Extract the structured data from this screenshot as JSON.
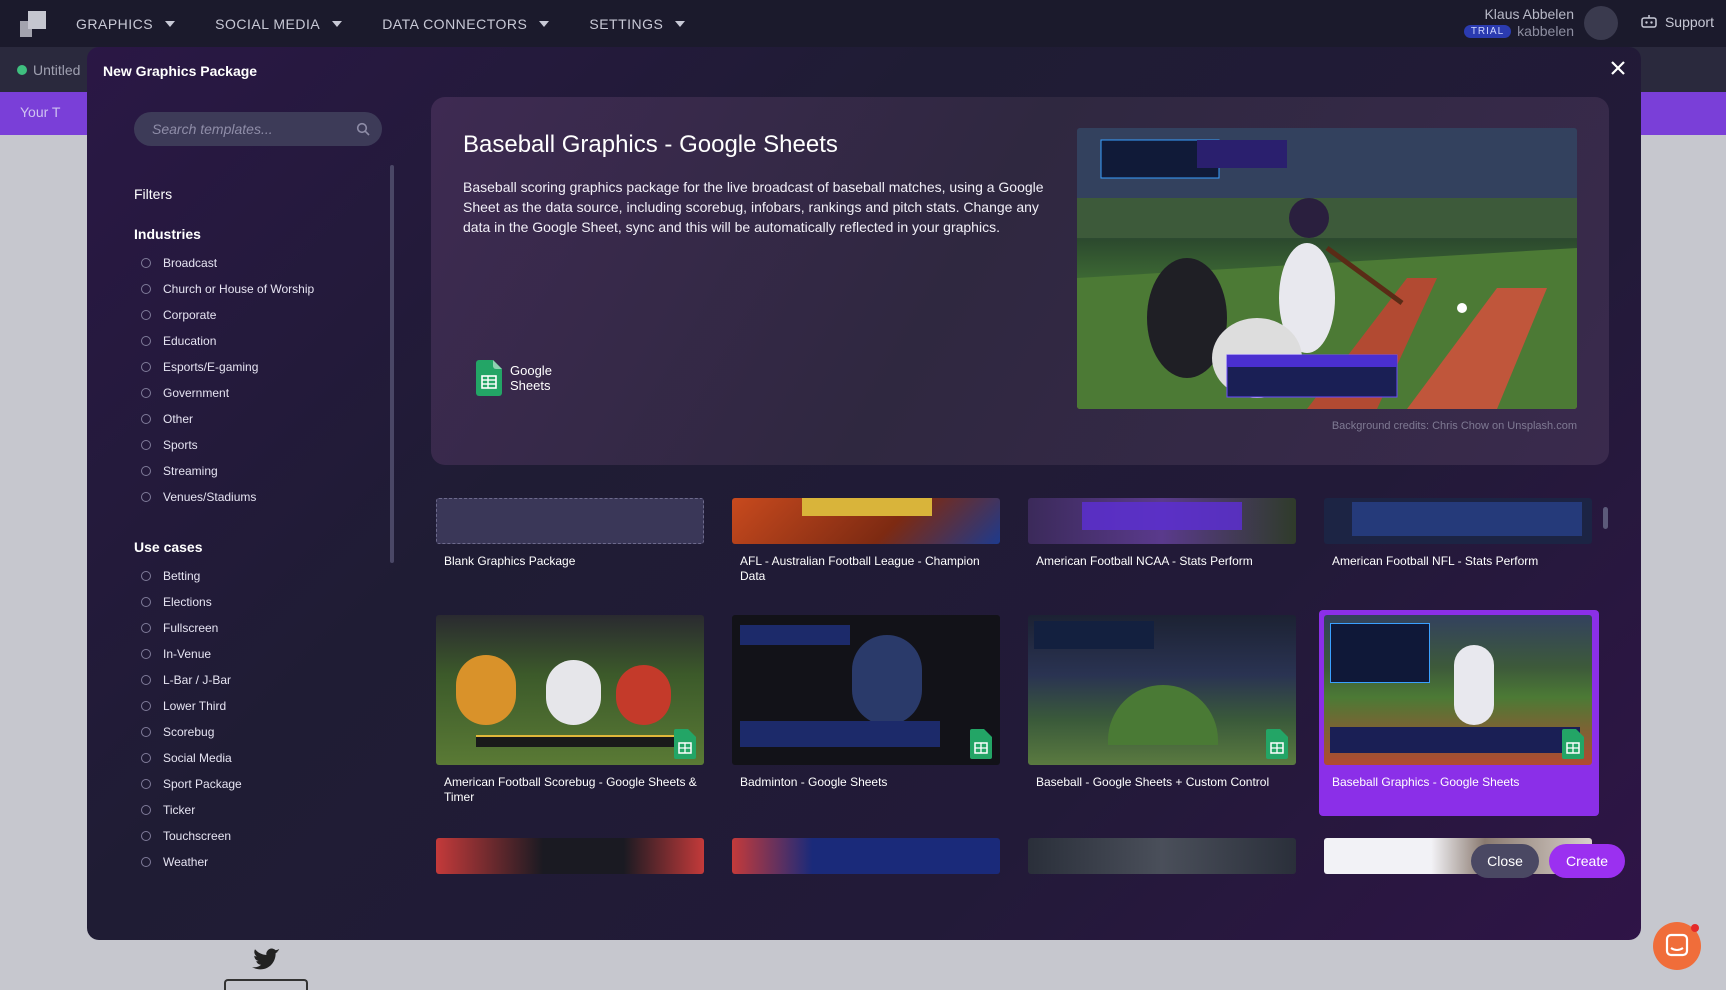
{
  "nav": {
    "items": [
      "GRAPHICS",
      "SOCIAL MEDIA",
      "DATA CONNECTORS",
      "SETTINGS"
    ],
    "user_name": "Klaus Abbelen",
    "trial_badge": "TRIAL",
    "username": "kabbelen",
    "support": "Support"
  },
  "background": {
    "project_status": "Untitled",
    "your_label": "Your T"
  },
  "modal": {
    "title": "New Graphics Package",
    "search_placeholder": "Search templates...",
    "filters_title": "Filters",
    "industries_title": "Industries",
    "industries": [
      "Broadcast",
      "Church or House of Worship",
      "Corporate",
      "Education",
      "Esports/E-gaming",
      "Government",
      "Other",
      "Sports",
      "Streaming",
      "Venues/Stadiums"
    ],
    "usecases_title": "Use cases",
    "usecases": [
      "Betting",
      "Elections",
      "Fullscreen",
      "In-Venue",
      "L-Bar / J-Bar",
      "Lower Third",
      "Scorebug",
      "Social Media",
      "Sport Package",
      "Ticker",
      "Touchscreen",
      "Weather"
    ],
    "hero": {
      "title": "Baseball Graphics - Google Sheets",
      "description": "Baseball scoring graphics package for the live broadcast of baseball matches, using a Google Sheet as the data source, including scorebug, infobars, rankings and pitch stats. Change any data in the Google Sheet, sync and this will be automatically reflected in your graphics.",
      "logo_line1": "Google",
      "logo_line2": "Sheets",
      "credits": "Background credits: Chris Chow on Unsplash.com"
    },
    "cards": [
      "Blank Graphics Package",
      "AFL - Australian Football League - Champion Data",
      "American Football NCAA - Stats Perform",
      "American Football NFL - Stats Perform",
      "American Football Scorebug - Google Sheets & Timer",
      "Badminton - Google Sheets",
      "Baseball - Google Sheets + Custom Control",
      "Baseball Graphics - Google Sheets"
    ],
    "close_button": "Close",
    "create_button": "Create"
  }
}
